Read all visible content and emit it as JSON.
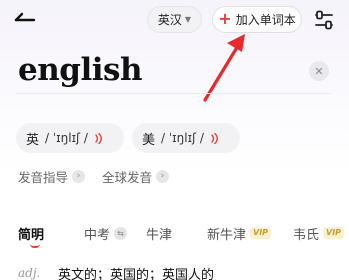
{
  "header": {
    "language": "英汉",
    "add_wordbook": "加入单词本"
  },
  "search": {
    "query": "english"
  },
  "pronunciation": {
    "uk": {
      "label": "英",
      "phonetic": "/ ˈɪŋlɪʃ /"
    },
    "us": {
      "label": "美",
      "phonetic": "/ ˈɪŋlɪʃ /"
    }
  },
  "links": {
    "guide": "发音指导",
    "global": "全球发音"
  },
  "tabs": [
    {
      "label": "简明"
    },
    {
      "label": "中考"
    },
    {
      "label": "牛津"
    },
    {
      "label": "新牛津",
      "badge": "VIP"
    },
    {
      "label": "韦氏",
      "badge": "VIP"
    }
  ],
  "definition": {
    "pos": "adj.",
    "text": "英文的；英国的；英国人的"
  },
  "colors": {
    "accent": "#e8423f",
    "vip": "#c99a2e"
  },
  "icons": [
    "back-arrow-icon",
    "dropdown-caret-icon",
    "plus-icon",
    "settings-sliders-icon",
    "clear-icon",
    "speaker-icon",
    "chevron-right-icon",
    "swap-icon"
  ]
}
